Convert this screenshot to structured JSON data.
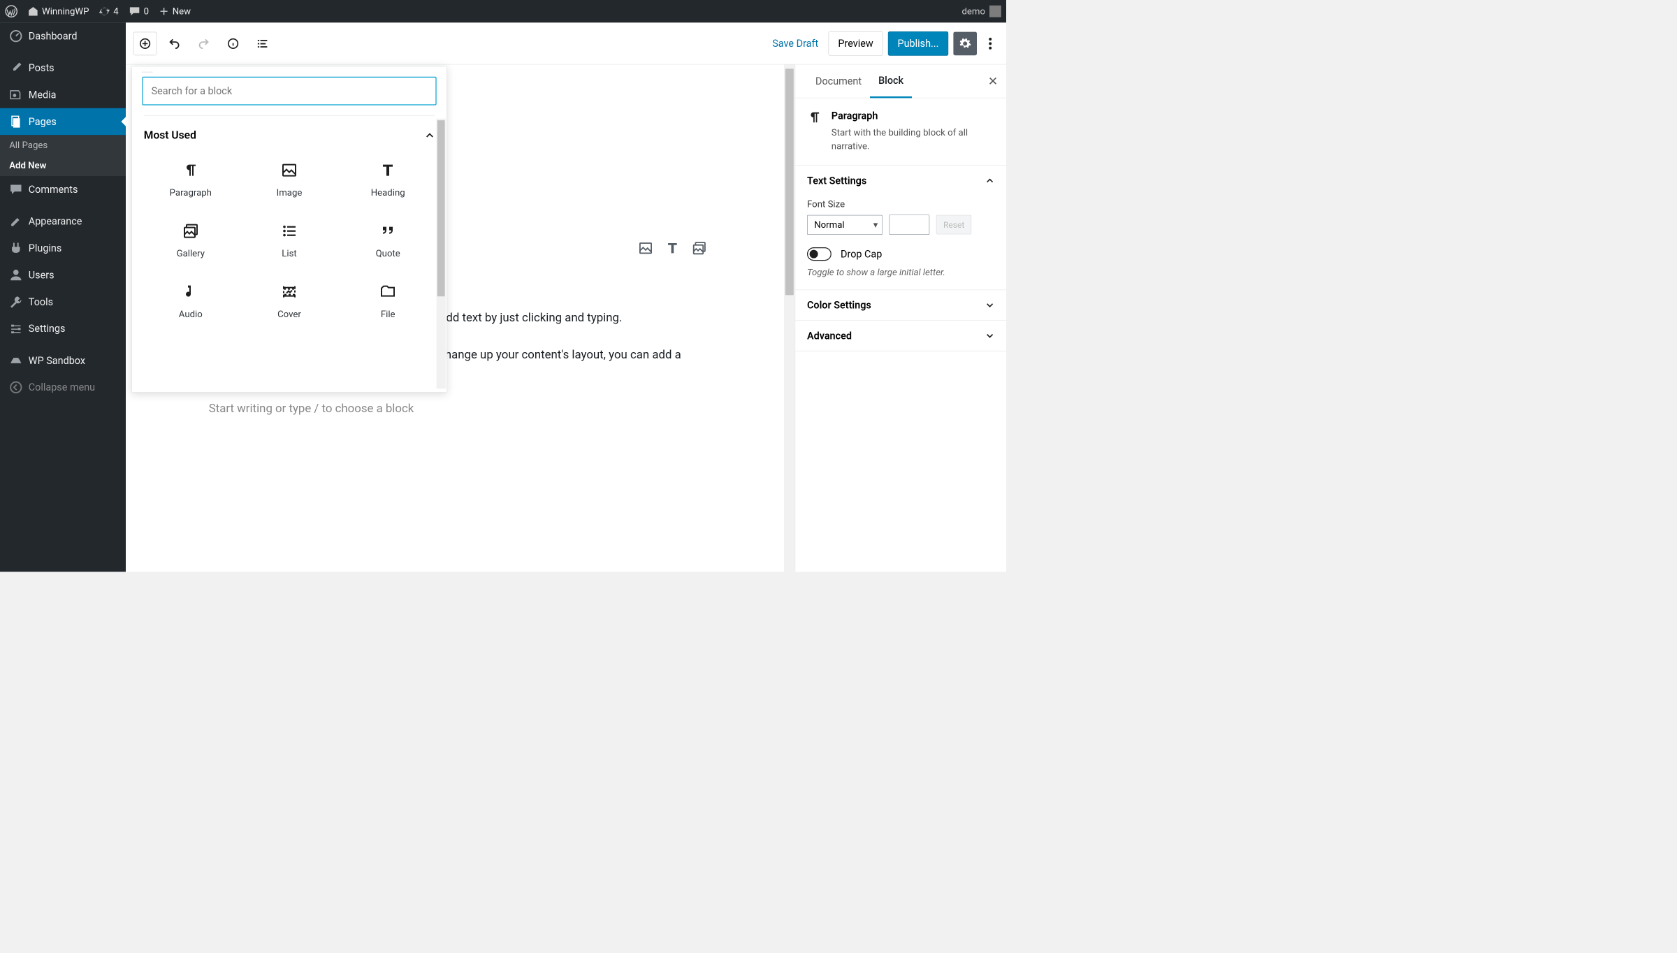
{
  "adminbar": {
    "site_name": "WinningWP",
    "updates_count": "4",
    "comments_count": "0",
    "new_label": "New",
    "user_name": "demo"
  },
  "sidebar": {
    "dashboard": "Dashboard",
    "posts": "Posts",
    "media": "Media",
    "pages": "Pages",
    "pages_sub_all": "All Pages",
    "pages_sub_add": "Add New",
    "comments": "Comments",
    "appearance": "Appearance",
    "plugins": "Plugins",
    "users": "Users",
    "tools": "Tools",
    "settings": "Settings",
    "sandbox": "WP Sandbox",
    "collapse": "Collapse menu"
  },
  "editor": {
    "save_draft": "Save Draft",
    "preview": "Preview",
    "publish": "Publish...",
    "paragraph1": "This is the native WordPress editor. You can add text by just clicking and typing.",
    "paragraph2": "Or, if you want to add multimedia content or change up your content's layout, you can add a block by clicking the \"plus\" icon",
    "placeholder_block": "Start writing or type / to choose a block"
  },
  "inserter": {
    "search_placeholder": "Search for a block",
    "category": "Most Used",
    "blocks": {
      "paragraph": "Paragraph",
      "image": "Image",
      "heading": "Heading",
      "gallery": "Gallery",
      "list": "List",
      "quote": "Quote",
      "audio": "Audio",
      "cover": "Cover",
      "file": "File"
    }
  },
  "settings": {
    "tab_document": "Document",
    "tab_block": "Block",
    "block_title": "Paragraph",
    "block_desc": "Start with the building block of all narrative.",
    "text_settings": "Text Settings",
    "font_size_label": "Font Size",
    "font_size_value": "Normal",
    "reset": "Reset",
    "drop_cap": "Drop Cap",
    "drop_cap_hint": "Toggle to show a large initial letter.",
    "color_settings": "Color Settings",
    "advanced": "Advanced"
  }
}
